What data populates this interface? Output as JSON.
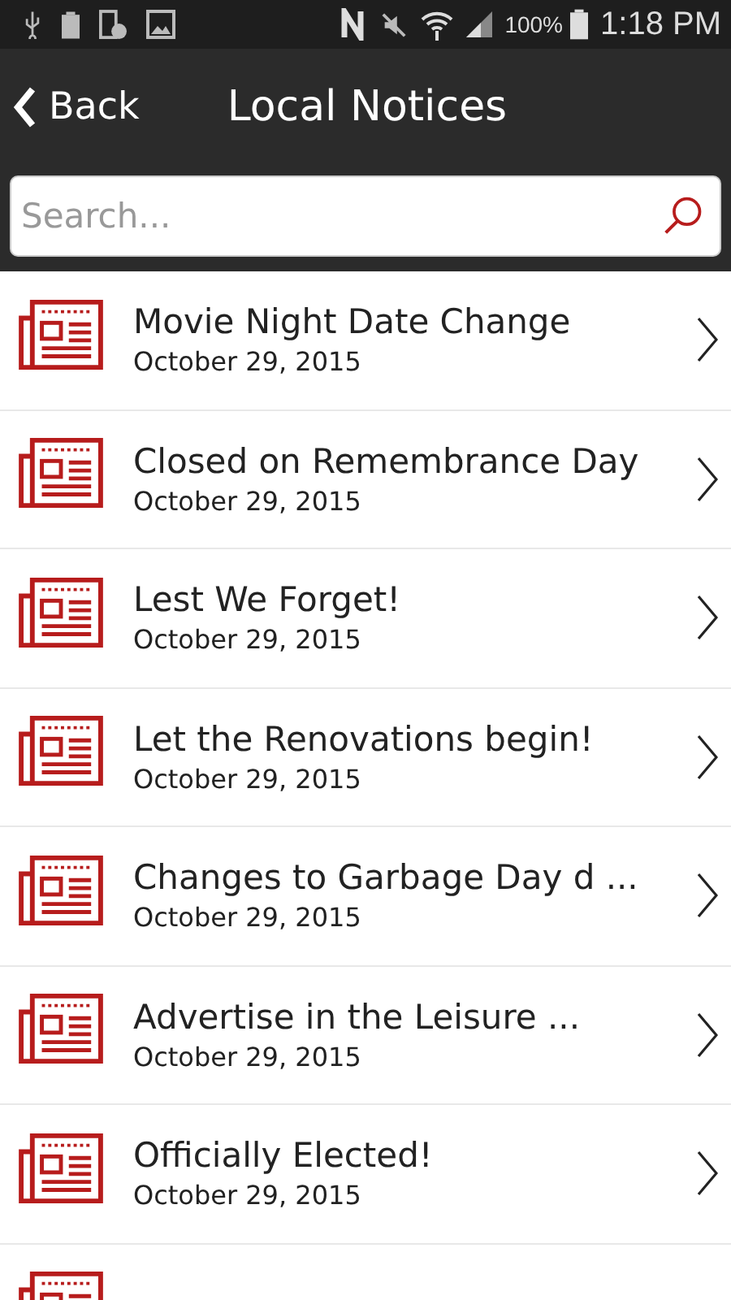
{
  "status_bar": {
    "battery_text": "100%",
    "time": "1:18 PM"
  },
  "header": {
    "back": "Back",
    "title": "Local Notices"
  },
  "search": {
    "placeholder": "Search..."
  },
  "notices": [
    {
      "kind": "full",
      "title": "Movie Night Date Change",
      "date": "October 29, 2015"
    },
    {
      "kind": "full",
      "title": "Closed on Remembrance Day",
      "date": "October 29, 2015"
    },
    {
      "kind": "full",
      "title": "Lest We Forget!",
      "date": "October 29, 2015"
    },
    {
      "kind": "full",
      "title": "Let the Renovations begin!",
      "date": "October 29, 2015"
    },
    {
      "kind": "full",
      "title": "Changes to Garbage Day d ...",
      "date": "October 29, 2015"
    },
    {
      "kind": "full",
      "title": "Advertise in the Leisure ...",
      "date": "October 29, 2015"
    },
    {
      "kind": "full",
      "title": "Officially Elected!",
      "date": "October 29, 2015"
    },
    {
      "kind": "cut_off"
    }
  ]
}
